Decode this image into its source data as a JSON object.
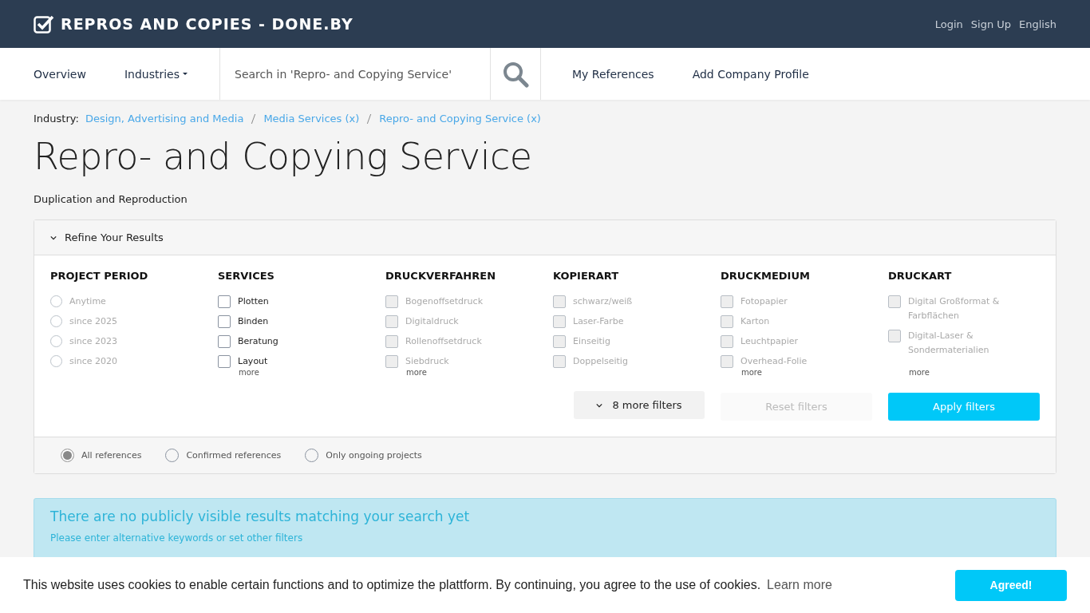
{
  "brand": {
    "title": "REPROS AND COPIES - DONE.BY"
  },
  "top_links": [
    "Login",
    "Sign Up",
    "English"
  ],
  "nav": [
    {
      "label": "Overview",
      "kind": "link"
    },
    {
      "label": "Industries",
      "kind": "dropdown"
    }
  ],
  "search": {
    "placeholder": "Search in 'Repro- and Copying Service'"
  },
  "nav_right": [
    "My References",
    "Add Company Profile"
  ],
  "breadcrumb": {
    "label": "Industry:",
    "items": [
      "Design, Advertising and Media",
      "Media Services (x)",
      "Repro- and Copying Service (x)"
    ]
  },
  "page_title": "Repro- and Copying Service",
  "subtitle": "Duplication and Reproduction",
  "refine": {
    "title": "Refine Your Results",
    "expanded": true
  },
  "filters": [
    {
      "title": "PROJECT PERIOD",
      "kind": "radio",
      "options": [
        {
          "label": "Anytime",
          "disabled": true,
          "checked": false
        },
        {
          "label": "since 2025",
          "disabled": true,
          "checked": false
        },
        {
          "label": "since 2023",
          "disabled": true,
          "checked": false
        },
        {
          "label": "since 2020",
          "disabled": true,
          "checked": false
        }
      ]
    },
    {
      "title": "SERVICES",
      "kind": "checkbox",
      "more": "more",
      "options": [
        {
          "label": "Plotten",
          "disabled": false,
          "checked": false
        },
        {
          "label": "Binden",
          "disabled": false,
          "checked": false
        },
        {
          "label": "Beratung",
          "disabled": false,
          "checked": false
        },
        {
          "label": "Layout",
          "disabled": false,
          "checked": false
        }
      ]
    },
    {
      "title": "DRUCKVERFAHREN",
      "kind": "checkbox",
      "more": "more",
      "options": [
        {
          "label": "Bogenoffsetdruck",
          "disabled": true,
          "checked": false
        },
        {
          "label": "Digitaldruck",
          "disabled": true,
          "checked": false
        },
        {
          "label": "Rollenoffsetdruck",
          "disabled": true,
          "checked": false
        },
        {
          "label": "Siebdruck",
          "disabled": true,
          "checked": false
        }
      ]
    },
    {
      "title": "KOPIERART",
      "kind": "checkbox",
      "options": [
        {
          "label": "schwarz/weiß",
          "disabled": true,
          "checked": false
        },
        {
          "label": "Laser-Farbe",
          "disabled": true,
          "checked": false
        },
        {
          "label": "Einseitig",
          "disabled": true,
          "checked": false
        },
        {
          "label": "Doppelseitig",
          "disabled": true,
          "checked": false
        }
      ]
    },
    {
      "title": "DRUCKMEDIUM",
      "kind": "checkbox",
      "more": "more",
      "options": [
        {
          "label": "Fotopapier",
          "disabled": true,
          "checked": false
        },
        {
          "label": "Karton",
          "disabled": true,
          "checked": false
        },
        {
          "label": "Leuchtpapier",
          "disabled": true,
          "checked": false
        },
        {
          "label": "Overhead-Folie",
          "disabled": true,
          "checked": false
        }
      ]
    },
    {
      "title": "DRUCKART",
      "kind": "checkbox",
      "more": "more",
      "options": [
        {
          "label": "Digital Großformat & Farbflächen",
          "disabled": true,
          "checked": false
        },
        {
          "label": "Digital-Laser & Sondermaterialien",
          "disabled": true,
          "checked": false
        }
      ]
    }
  ],
  "buttons": [
    {
      "label": "8 more filters",
      "kind": "more"
    },
    {
      "label": "Reset filters",
      "kind": "reset",
      "disabled": true
    },
    {
      "label": "Apply filters",
      "kind": "apply"
    }
  ],
  "reference_options": [
    {
      "label": "All references",
      "selected": true
    },
    {
      "label": "Confirmed references",
      "selected": false
    },
    {
      "label": "Only ongoing projects",
      "selected": false
    }
  ],
  "notice": {
    "title": "There are no publicly visible results matching your search yet",
    "text": "Please enter alternative keywords or set other filters"
  },
  "cookie": {
    "text": "This website uses cookies to enable certain functions and to optimize the plattform. By continuing, you agree to the use of cookies.",
    "link": "Learn more",
    "button": "Agreed!"
  }
}
